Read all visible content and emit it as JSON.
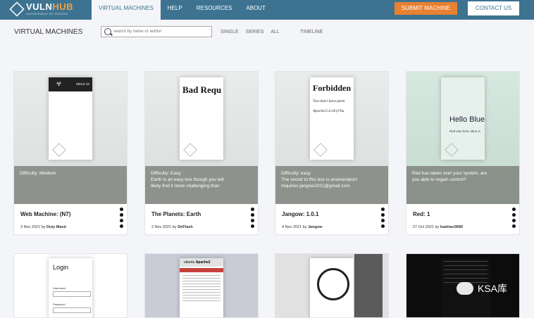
{
  "brand": {
    "name_main": "VULN",
    "name_accent": "HUB",
    "tagline": "VULNERABLE BY DESIGN"
  },
  "nav": {
    "items": [
      "VIRTUAL MACHINES",
      "HELP",
      "RESOURCES",
      "ABOUT"
    ],
    "submit": "SUBMIT MACHINE",
    "contact": "CONTACT US"
  },
  "page": {
    "title": "VIRTUAL MACHINES",
    "search_placeholder": "search by name or author",
    "filters": [
      "SINGLE",
      "SERIES",
      "ALL"
    ],
    "timeline": "TIMELINE"
  },
  "colors": {
    "topbar": "#3d7391",
    "accent": "#e88131"
  },
  "cards": [
    {
      "title": "Web Machine: (N7)",
      "date": "3 Nov 2021 by",
      "author": "Duty Mastr",
      "overlay": [
        "Difficulty: Medium"
      ],
      "shot_title": "about us"
    },
    {
      "title": "The Planets: Earth",
      "date": "2 Nov 2021 by",
      "author": "SirFlash",
      "overlay": [
        "Difficulty: Easy",
        "Earth is an easy box though you will",
        "likely find it more challenging than"
      ],
      "shot_title": "Bad Requ"
    },
    {
      "title": "Jangow: 1.0.1",
      "date": "4 Nov 2021 by",
      "author": "Jangow",
      "overlay": [
        "Difficulty: easy",
        "The secret to this box is enumeration!",
        "Inquiries jangow2021@gmail.com"
      ],
      "shot_title": "Forbidden",
      "shot_line1": "You don't have perm",
      "shot_line2": "Apache/2.4.18 (Ubu"
    },
    {
      "title": "Red: 1",
      "date": "27 Oct 2021 by",
      "author": "hadrian3689",
      "overlay": [
        "Red has taken over your system, are",
        "you able to regain control?"
      ],
      "shot_title": "Hello Blue",
      "shot_line1": "Red was here, Blue is"
    }
  ],
  "row2": {
    "login_title": "Login",
    "username": "Username",
    "password": "Password",
    "apache": "Apache2",
    "ubuntu": "ubuntu"
  },
  "watermark": "KSA库"
}
